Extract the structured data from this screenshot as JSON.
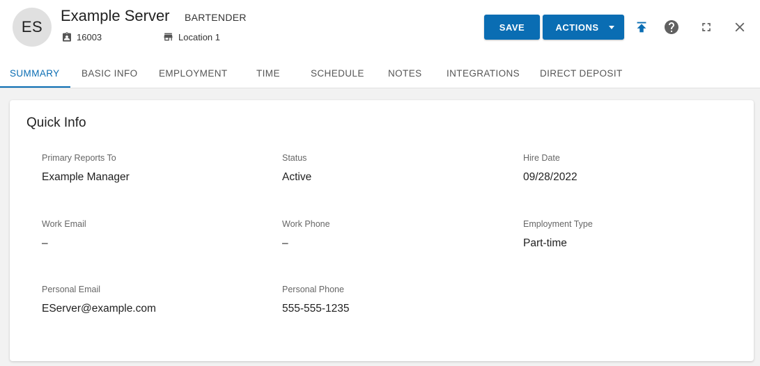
{
  "employee": {
    "initials": "ES",
    "name": "Example Server",
    "role": "BARTENDER",
    "id": "16003",
    "location": "Location 1"
  },
  "toolbar": {
    "save_label": "SAVE",
    "actions_label": "ACTIONS"
  },
  "tabs": [
    {
      "label": "SUMMARY"
    },
    {
      "label": "BASIC INFO"
    },
    {
      "label": "EMPLOYMENT"
    },
    {
      "label": "TIME"
    },
    {
      "label": "SCHEDULE"
    },
    {
      "label": "NOTES"
    },
    {
      "label": "INTEGRATIONS"
    },
    {
      "label": "DIRECT DEPOSIT"
    }
  ],
  "quick_info": {
    "title": "Quick Info",
    "fields": [
      {
        "label": "Primary Reports To",
        "value": "Example Manager"
      },
      {
        "label": "Status",
        "value": "Active"
      },
      {
        "label": "Hire Date",
        "value": "09/28/2022"
      },
      {
        "label": "Work Email",
        "value": "–"
      },
      {
        "label": "Work Phone",
        "value": "–"
      },
      {
        "label": "Employment Type",
        "value": "Part-time"
      },
      {
        "label": "Personal Email",
        "value": "EServer@example.com"
      },
      {
        "label": "Personal Phone",
        "value": "555-555-1235"
      }
    ]
  },
  "colors": {
    "accent": "#0a6db3",
    "avatar_bg": "#e0e0e0"
  },
  "icons": {
    "id": "badge-icon",
    "location": "store-icon",
    "upload": "upload-icon",
    "help": "help-icon",
    "expand": "fullscreen-icon",
    "close": "close-icon"
  }
}
